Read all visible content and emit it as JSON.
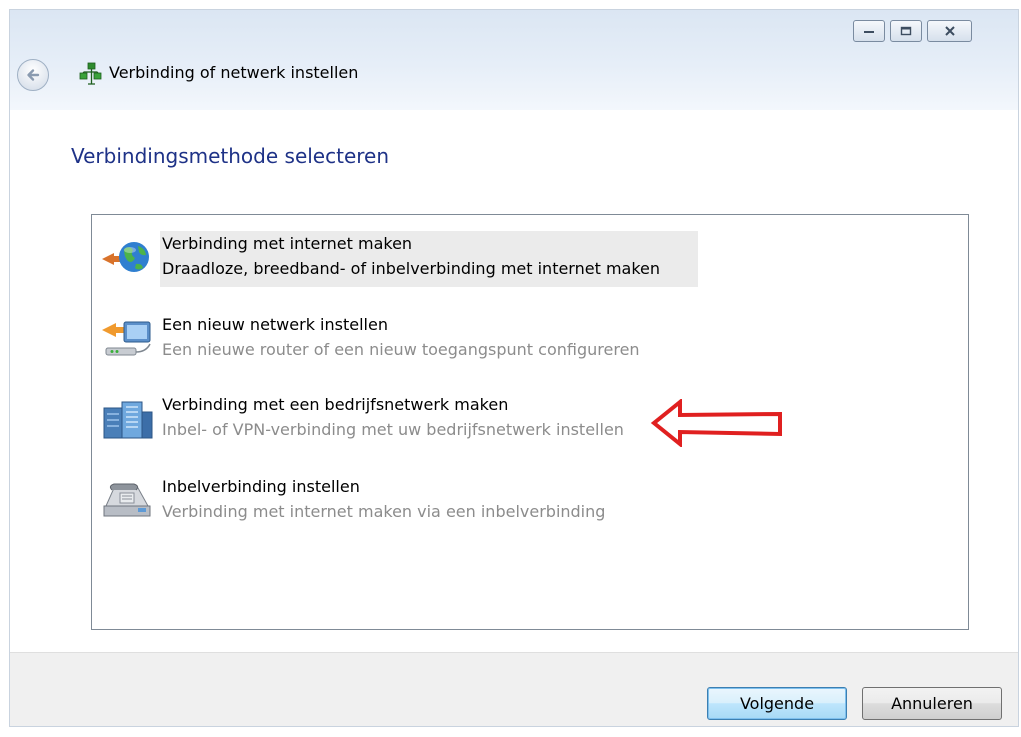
{
  "window": {
    "title": "Verbinding of netwerk instellen",
    "controls": {
      "minimize": "minimize",
      "maximize": "maximize",
      "close": "close"
    }
  },
  "page": {
    "heading": "Verbindingsmethode selecteren"
  },
  "options": [
    {
      "title": "Verbinding met internet maken",
      "description": "Draadloze, breedband- of inbelverbinding met internet maken",
      "icon": "globe-connect-icon",
      "selected": true
    },
    {
      "title": "Een nieuw netwerk instellen",
      "description": "Een nieuwe router of een nieuw toegangspunt configureren",
      "icon": "network-router-icon",
      "selected": false
    },
    {
      "title": "Verbinding met een bedrijfsnetwerk maken",
      "description": "Inbel- of VPN-verbinding met uw bedrijfsnetwerk instellen",
      "icon": "office-building-icon",
      "selected": false
    },
    {
      "title": "Inbelverbinding instellen",
      "description": "Verbinding met internet maken via een inbelverbinding",
      "icon": "telephone-modem-icon",
      "selected": false
    }
  ],
  "buttons": {
    "next": "Volgende",
    "cancel": "Annuleren"
  },
  "colors": {
    "heading": "#1e3287",
    "annotation_arrow": "#e02020",
    "primary_button_border": "#3c7fb1"
  }
}
